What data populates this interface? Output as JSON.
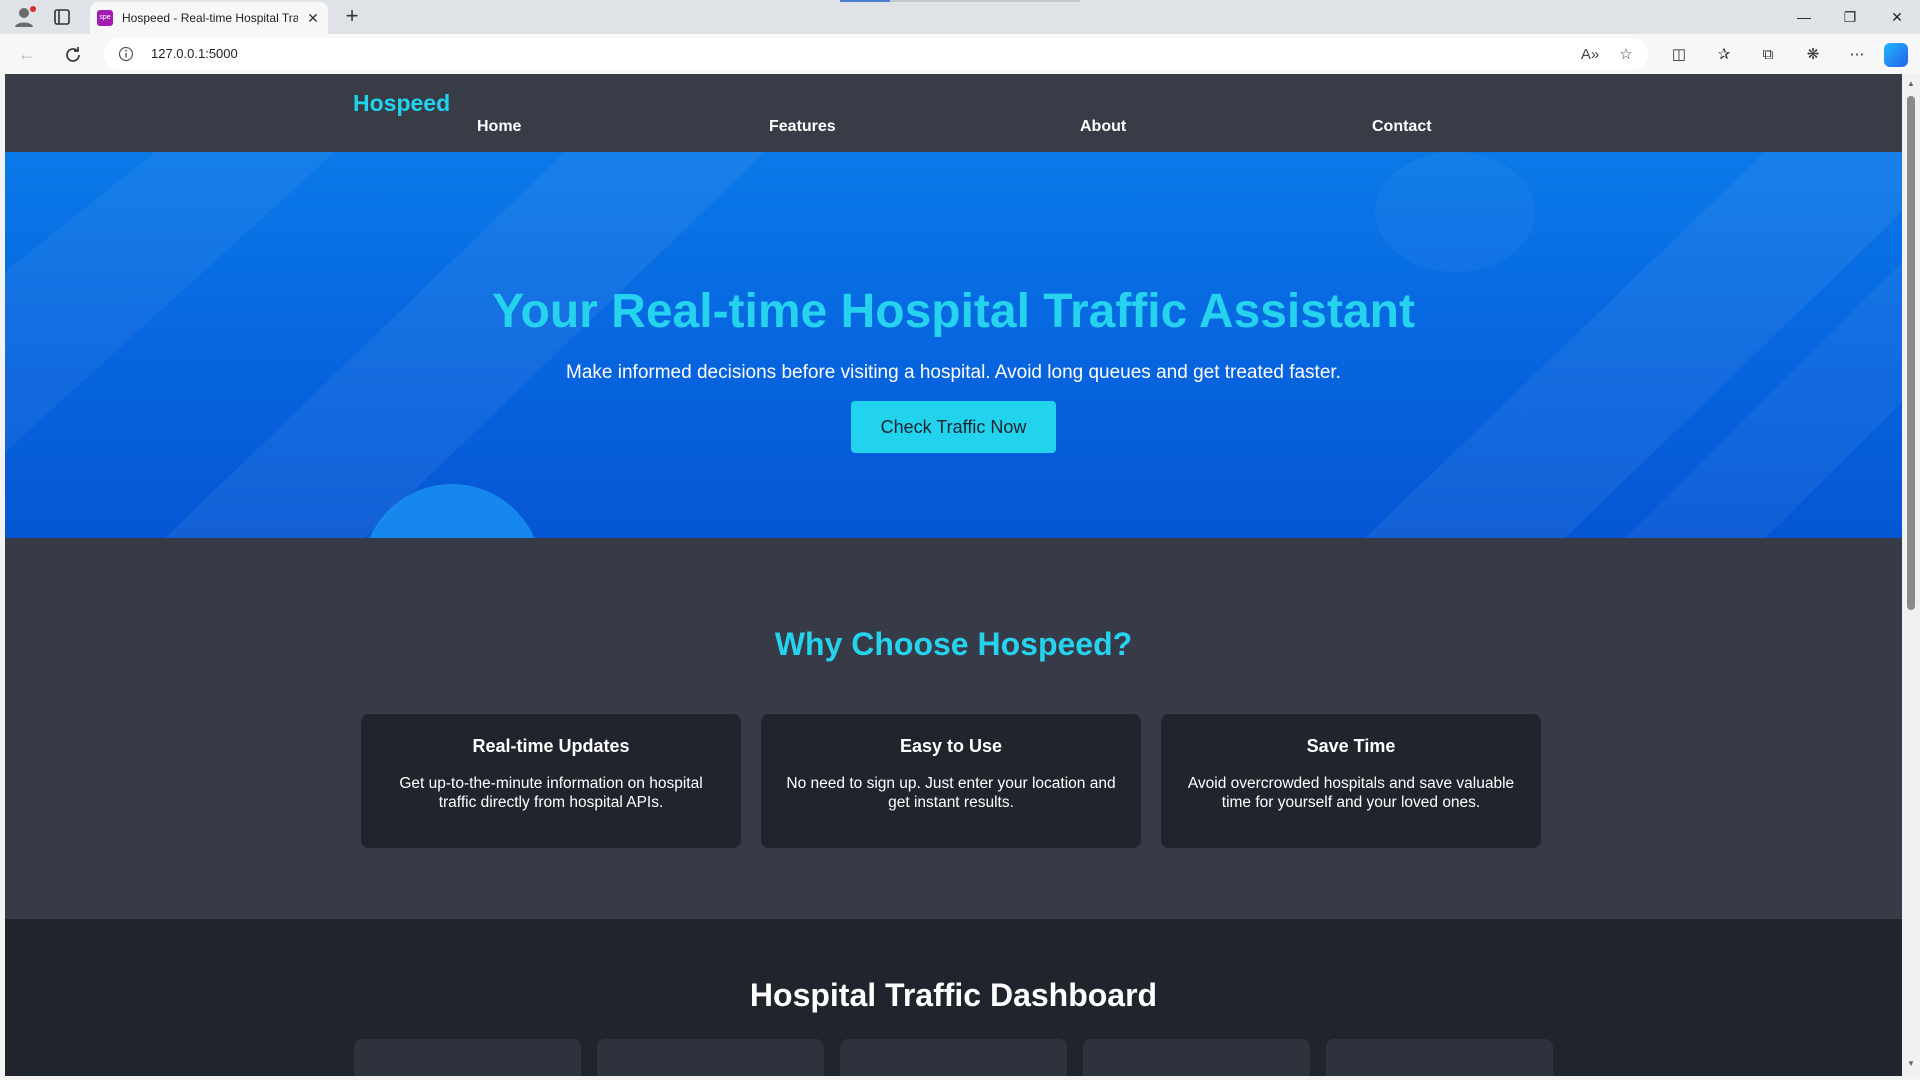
{
  "browser": {
    "tab_title": "Hospeed - Real-time Hospital Traffic Assistant",
    "tab_favicon_text": "spe",
    "url": "127.0.0.1:5000"
  },
  "site": {
    "logo": "Hospeed",
    "nav": [
      "Home",
      "Features",
      "About",
      "Contact"
    ]
  },
  "hero": {
    "title": "Your Real-time Hospital Traffic Assistant",
    "subtitle": "Make informed decisions before visiting a hospital. Avoid long queues and get treated faster.",
    "cta_label": "Check Traffic Now"
  },
  "features": {
    "title": "Why Choose Hospeed?",
    "items": [
      {
        "title": "Real-time Updates",
        "text": "Get up-to-the-minute information on hospital traffic directly from hospital APIs."
      },
      {
        "title": "Easy to Use",
        "text": "No need to sign up. Just enter your location and get instant results."
      },
      {
        "title": "Save Time",
        "text": "Avoid overcrowded hospitals and save valuable time for yourself and your loved ones."
      }
    ]
  },
  "dashboard": {
    "title": "Hospital Traffic Dashboard"
  },
  "colors": {
    "accent": "#22d3ee",
    "nav_bg": "#373c47",
    "hero_blue": "#0764df",
    "card_bg": "#20242c"
  },
  "icons": [
    "profile-icon",
    "tabs-icon",
    "close-icon",
    "new-tab-icon",
    "minimize-icon",
    "restore-icon",
    "window-close-icon",
    "back-icon",
    "reload-icon",
    "info-icon",
    "read-aloud-icon",
    "favorite-star-icon",
    "split-screen-icon",
    "favorites-icon",
    "collections-icon",
    "extensions-icon",
    "more-icon",
    "copilot-icon"
  ]
}
